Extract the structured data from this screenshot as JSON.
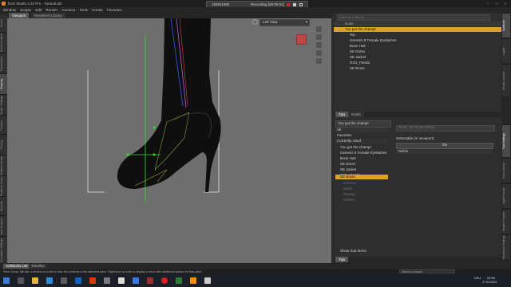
{
  "titlebar": {
    "title": "DAZ Studio 4.22 Pro - Tutorial.duf",
    "min": "–",
    "max": "□",
    "close": "×"
  },
  "recorder": {
    "resolution": "1920x1080",
    "status": "Recording [00:00:51]"
  },
  "menu": [
    "Window",
    "Scripts",
    "Edit",
    "Render",
    "Connect",
    "Tools",
    "Create",
    "Favorites"
  ],
  "left_tabs": [
    "Scene",
    "Smart Content",
    "Parameters",
    "Shaping",
    "Render Settings",
    "Timeline",
    "Posing",
    "Content Library",
    "Product Library",
    "Animate",
    "Aux Viewport",
    "Simulation Settings"
  ],
  "viewport": {
    "tabs": [
      "Viewport",
      "Rendered Library"
    ],
    "camera_select": "Left View"
  },
  "bottom_tabs": [
    "Aniblocks Lite",
    "Timeline"
  ],
  "status_text": "Pane Group Tab Bar: Left click on a tab to view the contents of the attached pane. Right click on a tab to display a menu with additional options for that pane.",
  "status_right": "Select a Lesson",
  "scene": {
    "search_placeholder": "Enter text to filter by...",
    "header": "Node",
    "items": [
      "You got the champ!",
      "Hip",
      "Genesis 8 Female Eyelashes",
      "Bone Hair",
      "SE Dress",
      "SE Jacket",
      "GG2_Panda",
      "SE Boots"
    ]
  },
  "lower_tabs": [
    "Tips",
    "Notes"
  ],
  "tool_settings": {
    "figure_select": "You got the champ!",
    "filter": "All",
    "favorites": "Favorites",
    "currently_used": "Currently Used",
    "list": [
      "You got the champ!",
      "Genesis 8 Female Eyelashes",
      "Bone Hair",
      "SE Dress",
      "SE Jacket",
      "GG2_Panda",
      "SE Boots"
    ],
    "sub_items": [
      "General",
      "Mesh",
      "Display",
      "Utilities"
    ],
    "show_sub_items": "Show Sub Items",
    "node_label": "Node: SE Boots (Bind)",
    "selectable_label": "Selectable (in Viewport)",
    "selectable_value": "On",
    "visible_label": "Visible"
  },
  "right_vtabs": [
    "Surfaces",
    "Lights",
    "Render Library",
    "Tool Settings",
    "Pose Library",
    "Light Presets",
    "Shader Presets",
    "Parameter Settings"
  ],
  "panel_bottom_tab": "Tips",
  "clock": {
    "time": "09:54",
    "date": "27.04.2024"
  },
  "tray": {
    "lang": "DEU"
  },
  "colors": {
    "accent": "#e0a020",
    "bone_green": "#33dd33",
    "record": "#e02020"
  }
}
